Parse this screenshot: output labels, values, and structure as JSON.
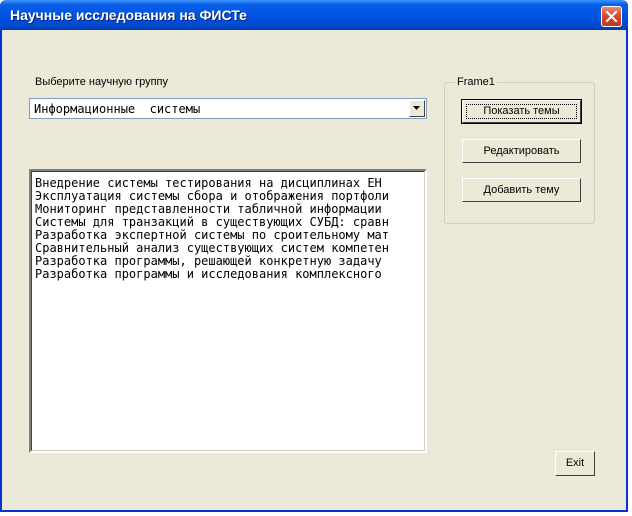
{
  "window": {
    "title": "Научные исследования на ФИСТе"
  },
  "group_select": {
    "label": "Выберите научную группу",
    "value": "Информационные  системы"
  },
  "topics": {
    "items": [
      "Внедрение системы тестирования на дисциплинах ЕН",
      "Эксплуатация системы сбора и отображения портфоли",
      "Мониторинг представленности табличной информации",
      "Системы для транзакций в существующих СУБД: сравн",
      "Разработка экспертной системы по сроительному мат",
      "Сравнительный анализ существующих систем компетен",
      "Разработка программы, решающей конкретную задачу ",
      "Разработка программы и исследования комплексного "
    ]
  },
  "frame": {
    "label": "Frame1",
    "show_topics": "Показать темы",
    "edit": "Редактировать",
    "add_topic": "Добавить тему"
  },
  "exit_label": "Exit",
  "colors": {
    "titlebar": "#0054e3",
    "face": "#ece9d8",
    "close": "#d4472a"
  }
}
